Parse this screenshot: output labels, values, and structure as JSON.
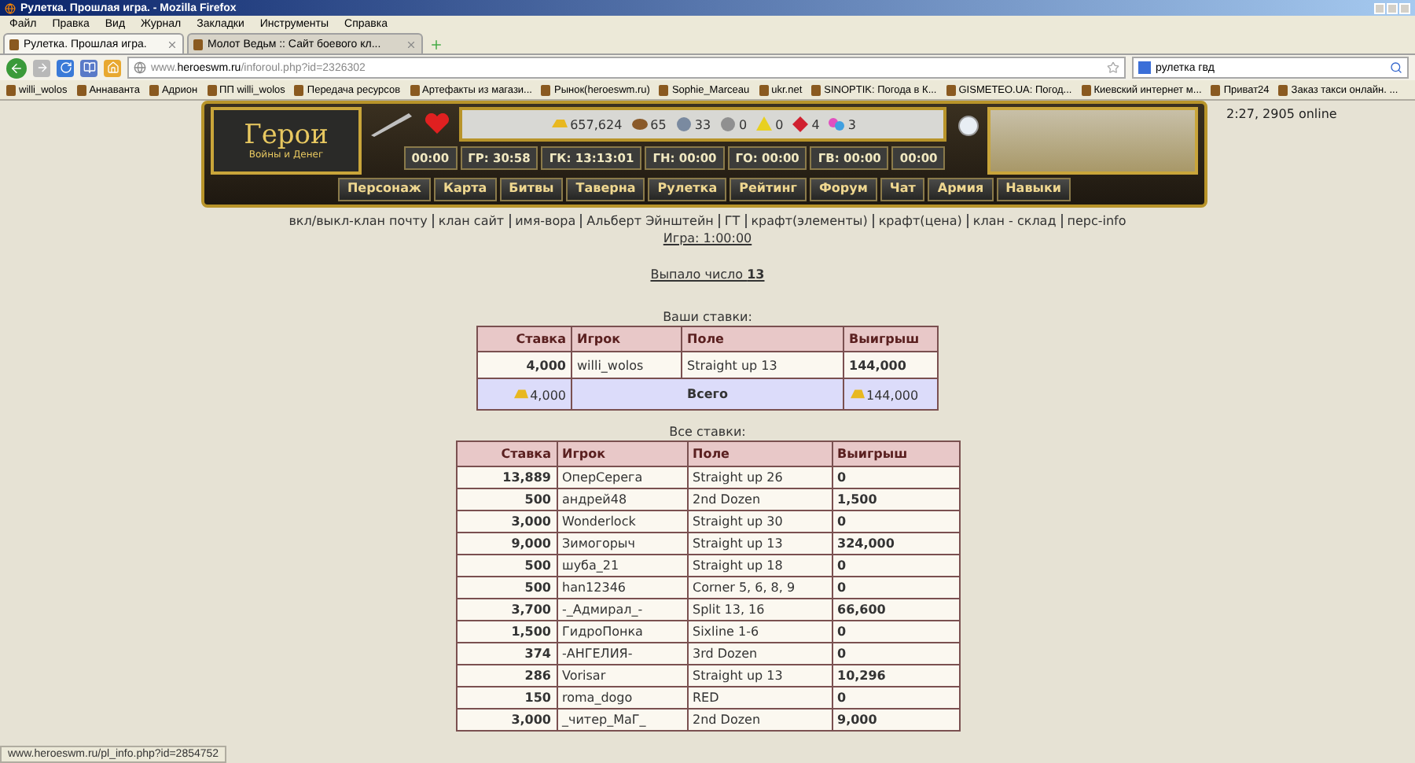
{
  "window": {
    "title": "Рулетка. Прошлая игра. - Mozilla Firefox"
  },
  "menu": [
    "Файл",
    "Правка",
    "Вид",
    "Журнал",
    "Закладки",
    "Инструменты",
    "Справка"
  ],
  "tabs": [
    {
      "label": "Рулетка. Прошлая игра.",
      "selected": true
    },
    {
      "label": "Молот Ведьм :: Сайт боевого кл...",
      "selected": false
    }
  ],
  "address": {
    "url": "www.**heroeswm.ru**/inforoul.php?id=2326302"
  },
  "search": {
    "value": "рулетка гвд"
  },
  "bookmarks": [
    "willi_wolos",
    "Аннаванта",
    "Адрион",
    "ПП willi_wolos",
    "Передача ресурсов",
    "Артефакты из магази...",
    "Рынок(heroeswm.ru)",
    "Sophie_Marceau",
    "ukr.net",
    "SINOPTIK: Погода в К...",
    "GISMETEO.UA: Погод...",
    "Киевский интернет м...",
    "Приват24",
    "Заказ такси онлайн. ..."
  ],
  "header": {
    "logo": {
      "title": "Герои",
      "subtitle": "Войны и Денег"
    },
    "resources": [
      {
        "kind": "gold",
        "value": "657,624"
      },
      {
        "kind": "wood",
        "value": "65"
      },
      {
        "kind": "ore",
        "value": "33"
      },
      {
        "kind": "mercury",
        "value": "0"
      },
      {
        "kind": "sulfur",
        "value": "0"
      },
      {
        "kind": "crystal",
        "value": "4"
      },
      {
        "kind": "gem",
        "value": "3"
      }
    ],
    "timers": [
      "00:00",
      "ГР: 30:58",
      "ГК: 13:13:01",
      "ГН: 00:00",
      "ГО: 00:00",
      "ГВ: 00:00",
      "00:00"
    ],
    "nav": [
      {
        "label": "Персонаж",
        "selected": false
      },
      {
        "label": "Карта",
        "selected": false
      },
      {
        "label": "Битвы",
        "selected": false
      },
      {
        "label": "Таверна",
        "selected": false
      },
      {
        "label": "Рулетка",
        "selected": false
      },
      {
        "label": "Рейтинг",
        "selected": false
      },
      {
        "label": "Форум",
        "selected": false
      },
      {
        "label": "Чат",
        "selected": false
      },
      {
        "label": "Армия",
        "selected": false
      },
      {
        "label": "Навыки",
        "selected": false
      }
    ],
    "online": "2:27, 2905 online"
  },
  "links": [
    "вкл/выкл-клан почту",
    "клан сайт",
    "имя-вора",
    "Альберт Эйнштейн",
    "ГТ",
    "крафт(элементы)",
    "крафт(цена)",
    "клан - склад",
    "перс-info"
  ],
  "game": "Игра: 1:00:00",
  "result": "Выпало число **13**",
  "your_bets": {
    "caption": "Ваши ставки:",
    "columns": [
      "Ставка",
      "Игрок",
      "Поле",
      "Выигрыш"
    ],
    "rows": [
      [
        "4,000",
        "willi_wolos",
        "Straight up 13",
        "144,000"
      ]
    ],
    "total": {
      "stake": "4,000",
      "label": "Всего",
      "winnings": "144,000"
    }
  },
  "all_bets": {
    "caption": "Все ставки:",
    "columns": [
      "Ставка",
      "Игрок",
      "Поле",
      "Выигрыш"
    ],
    "rows": [
      [
        "13,889",
        "ОперСерега",
        "Straight up 26",
        "0"
      ],
      [
        "500",
        "андрей48",
        "2nd Dozen",
        "1,500"
      ],
      [
        "3,000",
        "Wonderlock",
        "Straight up 30",
        "0"
      ],
      [
        "9,000",
        "Зимогорыч",
        "Straight up 13",
        "324,000"
      ],
      [
        "500",
        "шуба_21",
        "Straight up 18",
        "0"
      ],
      [
        "500",
        "han12346",
        "Corner 5, 6, 8, 9",
        "0"
      ],
      [
        "3,700",
        "-_Адмирал_-",
        "Split 13, 16",
        "66,600"
      ],
      [
        "1,500",
        "ГидроПонка",
        "Sixline 1-6",
        "0"
      ],
      [
        "374",
        "-АНГЕЛИЯ-",
        "3rd Dozen",
        "0"
      ],
      [
        "286",
        "Vorisar",
        "Straight up 13",
        "10,296"
      ],
      [
        "150",
        "roma_dogo",
        "RED",
        "0"
      ],
      [
        "3,000",
        "_читер_МаГ_",
        "2nd Dozen",
        "9,000"
      ]
    ]
  },
  "status_url": "www.heroeswm.ru/pl_info.php?id=2854752"
}
